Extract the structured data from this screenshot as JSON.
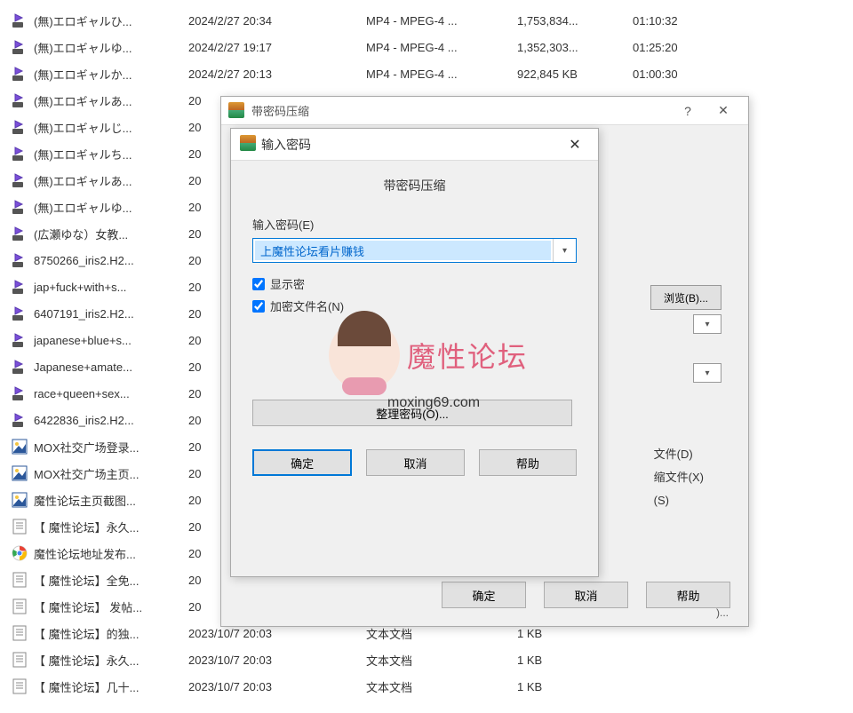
{
  "files": [
    {
      "icon": "video",
      "name": "(無)エロギャルひ...",
      "date": "2024/2/27 20:34",
      "type": "MP4 - MPEG-4 ...",
      "size": "1,753,834...",
      "duration": "01:10:32"
    },
    {
      "icon": "video",
      "name": "(無)エロギャルゆ...",
      "date": "2024/2/27 19:17",
      "type": "MP4 - MPEG-4 ...",
      "size": "1,352,303...",
      "duration": "01:25:20"
    },
    {
      "icon": "video",
      "name": "(無)エロギャルか...",
      "date": "2024/2/27 20:13",
      "type": "MP4 - MPEG-4 ...",
      "size": "922,845 KB",
      "duration": "01:00:30"
    },
    {
      "icon": "video",
      "name": "(無)エロギャルあ...",
      "date": "20",
      "type": "",
      "size": "",
      "duration": ""
    },
    {
      "icon": "video",
      "name": "(無)エロギャルじ...",
      "date": "20",
      "type": "",
      "size": "",
      "duration": ""
    },
    {
      "icon": "video",
      "name": "(無)エロギャルち...",
      "date": "20",
      "type": "",
      "size": "",
      "duration": ""
    },
    {
      "icon": "video",
      "name": "(無)エロギャルあ...",
      "date": "20",
      "type": "",
      "size": "",
      "duration": ""
    },
    {
      "icon": "video",
      "name": "(無)エロギャルゆ...",
      "date": "20",
      "type": "",
      "size": "",
      "duration": ""
    },
    {
      "icon": "video",
      "name": "(広瀬ゆな）女教...",
      "date": "20",
      "type": "",
      "size": "",
      "duration": ""
    },
    {
      "icon": "video",
      "name": "8750266_iris2.H2...",
      "date": "20",
      "type": "",
      "size": "",
      "duration": ""
    },
    {
      "icon": "video",
      "name": "jap+fuck+with+s...",
      "date": "20",
      "type": "",
      "size": "",
      "duration": ""
    },
    {
      "icon": "video",
      "name": "6407191_iris2.H2...",
      "date": "20",
      "type": "",
      "size": "",
      "duration": ""
    },
    {
      "icon": "video",
      "name": "japanese+blue+s...",
      "date": "20",
      "type": "",
      "size": "",
      "duration": ""
    },
    {
      "icon": "video",
      "name": "Japanese+amate...",
      "date": "20",
      "type": "",
      "size": "",
      "duration": ""
    },
    {
      "icon": "video",
      "name": "race+queen+sex...",
      "date": "20",
      "type": "",
      "size": "",
      "duration": ""
    },
    {
      "icon": "video",
      "name": "6422836_iris2.H2...",
      "date": "20",
      "type": "",
      "size": "",
      "duration": ""
    },
    {
      "icon": "image",
      "name": "MOX社交广场登录...",
      "date": "20",
      "type": "",
      "size": "",
      "duration": ""
    },
    {
      "icon": "image",
      "name": "MOX社交广场主页...",
      "date": "20",
      "type": "",
      "size": "",
      "duration": ""
    },
    {
      "icon": "image",
      "name": "魔性论坛主页截图...",
      "date": "20",
      "type": "",
      "size": "",
      "duration": ""
    },
    {
      "icon": "text",
      "name": "【 魔性论坛】永久...",
      "date": "20",
      "type": "",
      "size": "",
      "duration": ""
    },
    {
      "icon": "chrome",
      "name": "魔性论坛地址发布...",
      "date": "20",
      "type": "",
      "size": "",
      "duration": ""
    },
    {
      "icon": "text",
      "name": "【 魔性论坛】全免...",
      "date": "20",
      "type": "",
      "size": "",
      "duration": ""
    },
    {
      "icon": "text",
      "name": "【 魔性论坛】 发帖...",
      "date": "20",
      "type": "",
      "size": "",
      "duration": ""
    },
    {
      "icon": "text",
      "name": "【 魔性论坛】的独...",
      "date": "2023/10/7 20:03",
      "type": "文本文档",
      "size": "1 KB",
      "duration": ""
    },
    {
      "icon": "text",
      "name": "【 魔性论坛】永久...",
      "date": "2023/10/7 20:03",
      "type": "文本文档",
      "size": "1 KB",
      "duration": ""
    },
    {
      "icon": "text",
      "name": "【 魔性论坛】几十...",
      "date": "2023/10/7 20:03",
      "type": "文本文档",
      "size": "1 KB",
      "duration": ""
    }
  ],
  "main_dialog": {
    "title": "带密码压缩",
    "help_btn": "?",
    "close_btn": "✕",
    "browse": "浏览(B)...",
    "side_d": "文件(D)",
    "side_x": "缩文件(X)",
    "side_s": "(S)",
    "side_help2": ")...",
    "ok": "确定",
    "cancel": "取消",
    "help": "帮助"
  },
  "pw_dialog": {
    "title": "输入密码",
    "heading": "带密码压缩",
    "input_label": "输入密码(E)",
    "input_value": "上魔性论坛看片赚钱",
    "check_show": "显示密",
    "check_encrypt": "加密文件名(N)",
    "organize": "整理密码(O)...",
    "ok": "确定",
    "cancel": "取消",
    "help": "帮助"
  },
  "watermark": {
    "text": "魔性论坛",
    "url": "moxing69.com"
  }
}
